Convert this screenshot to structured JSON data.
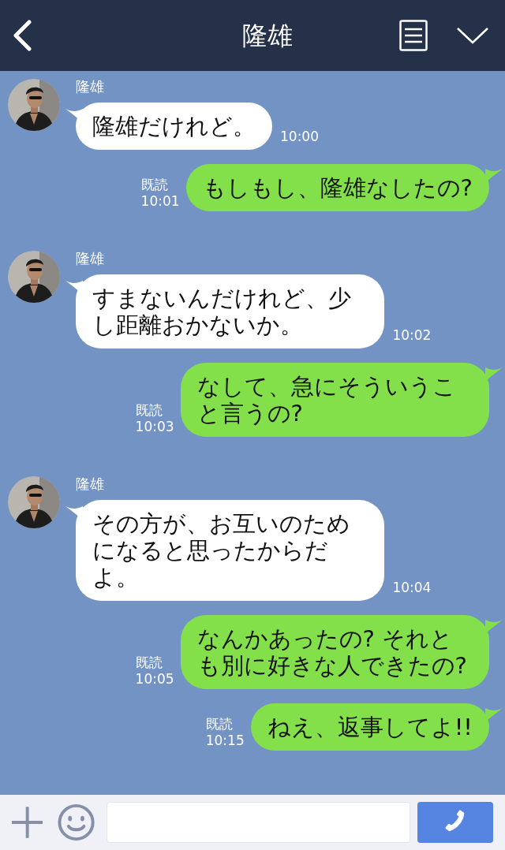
{
  "header": {
    "title": "隆雄"
  },
  "messages": [
    {
      "kind": "received",
      "name": "隆雄",
      "text": "隆雄だけれど。",
      "time": "10:00"
    },
    {
      "kind": "sent",
      "read": "既読",
      "time": "10:01",
      "text": "もしもし、隆雄なしたの?"
    },
    {
      "kind": "received",
      "name": "隆雄",
      "text": "すまないんだけれど、少し距離おかないか。",
      "time": "10:02"
    },
    {
      "kind": "sent",
      "read": "既読",
      "time": "10:03",
      "text": "なして、急にそういうこと言うの?"
    },
    {
      "kind": "received",
      "name": "隆雄",
      "text": "その方が、お互いのためになると思ったからだよ。",
      "time": "10:04"
    },
    {
      "kind": "sent",
      "read": "既読",
      "time": "10:05",
      "text": "なんかあったの? それとも別に好きな人できたの?"
    },
    {
      "kind": "sent",
      "read": "既読",
      "time": "10:15",
      "text": "ねえ、返事してよ!!"
    }
  ]
}
